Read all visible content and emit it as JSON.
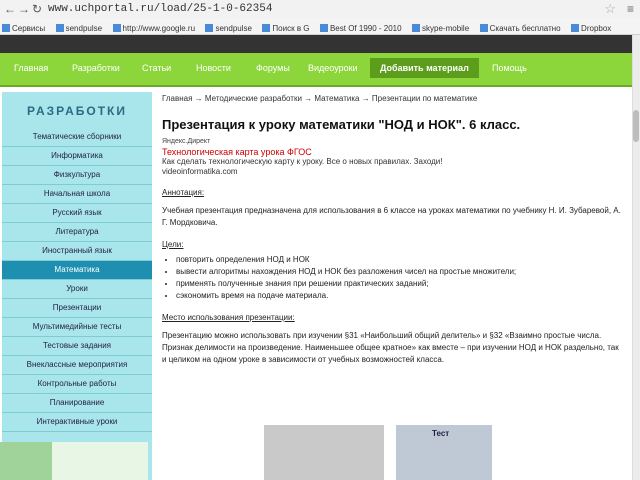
{
  "browser": {
    "url": "www.uchportal.ru/load/25-1-0-62354",
    "bookmarks": [
      "Сервисы",
      "sendpulse",
      "http://www.google.ru",
      "sendpulse",
      "Поиск в G",
      "Best Of 1990 - 2010",
      "skype-mobile",
      "Скачать бесплатно",
      "Dropbox"
    ]
  },
  "nav": {
    "items": [
      "Главная",
      "Разработки",
      "Статьи",
      "Новости",
      "Форумы",
      "Видеоуроки"
    ],
    "add_button": "Добавить материал",
    "help": "Помощь"
  },
  "sidebar": {
    "title": "РАЗРАБОТКИ",
    "items": [
      "Тематические сборники",
      "Информатика",
      "Физкультура",
      "Начальная школа",
      "Русский язык",
      "Литература",
      "Иностранный язык",
      "Математика",
      "Уроки",
      "Презентации",
      "Мультимедийные тесты",
      "Тестовые задания",
      "Внеклассные мероприятия",
      "Контрольные работы",
      "Планирование",
      "Интерактивные уроки"
    ],
    "active": "Математика"
  },
  "content": {
    "breadcrumb": "Главная → Методические разработки → Математика → Презентации по математике",
    "title": "Презентация к уроку математики \"НОД и НОК\". 6 класс.",
    "ad_header": "Яндекс.Директ",
    "ad_link": "Технологическая карта урока ФГОС",
    "ad_text": "Как сделать технологическую карту к уроку. Все о новых правилах. Заходи!",
    "ad_site": "videoinformatika.com",
    "annotation_label": "Аннотация:",
    "annotation_text": "Учебная презентация предназначена для использования в 6 классе на уроках математики по учебнику Н. И. Зубаревой, А. Г. Мордковича.",
    "goals_label": "Цели:",
    "goals": [
      "повторить определения НОД и НОК",
      "вывести алгоритмы нахождения НОД и НОК без разложения чисел на простые множители;",
      "применять полученные знания при решении практических заданий;",
      "сэкономить время на подаче материала."
    ],
    "place_label": "Место использования презентации:",
    "place_text": "Презентацию можно использовать при изучении §31 «Наибольший общий делитель» и §32 «Взаимно простые числа. Признак делимости на произведение. Наименьшее общее кратное» как вместе – при изучении НОД и НОК раздельно, так и целиком на одном уроке в зависимости от учебных возможностей класса.",
    "thumb_label": "Тест"
  }
}
